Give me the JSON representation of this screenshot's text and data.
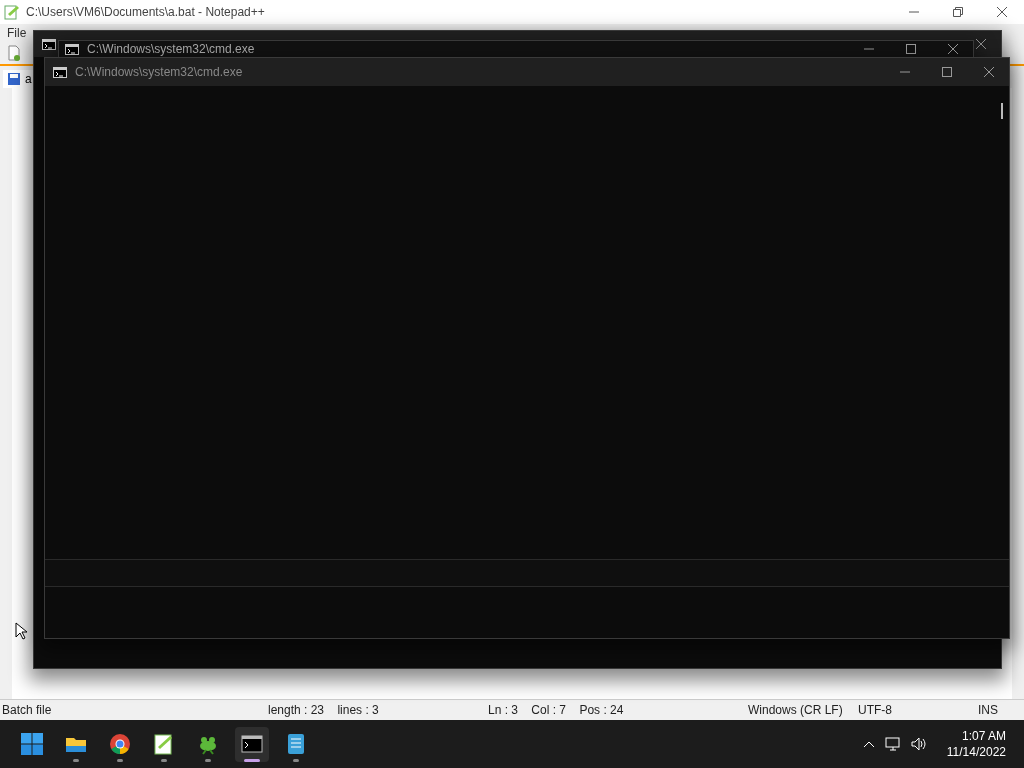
{
  "notepad": {
    "title": "C:\\Users\\VM6\\Documents\\a.bat - Notepad++",
    "menu": [
      "File"
    ],
    "tab": "a",
    "status": [
      "Batch file",
      "length : 23    lines : 3",
      "Ln : 3    Col : 7    Pos : 24",
      "Windows (CR LF)",
      "UTF-8",
      "INS"
    ]
  },
  "cmd_windows": [
    {
      "kind": "back"
    },
    {
      "kind": "middle",
      "title": "C:\\Windows\\system32\\cmd.exe"
    },
    {
      "kind": "front",
      "title": "C:\\Windows\\system32\\cmd.exe"
    }
  ],
  "taskbar": {
    "apps": [
      {
        "kind": "explorer",
        "active": false
      },
      {
        "kind": "chrome",
        "active": false
      },
      {
        "kind": "notepadpp",
        "active": false
      },
      {
        "kind": "frog",
        "active": false
      },
      {
        "kind": "terminal",
        "active": true
      },
      {
        "kind": "notepad",
        "active": false
      }
    ],
    "time": "1:07 AM",
    "date": "11/14/2022"
  }
}
